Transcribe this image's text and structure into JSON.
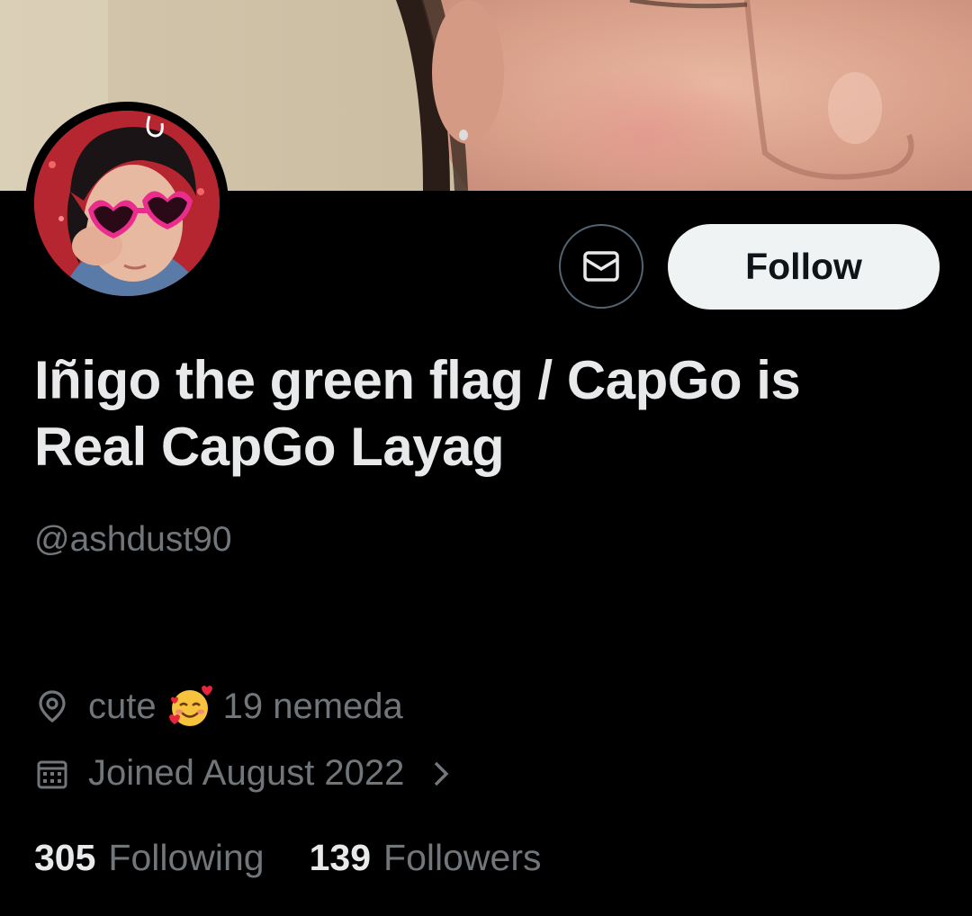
{
  "profile": {
    "display_name_line1": "Iñigo the green flag / CapGo is",
    "display_name_line2": "Real CapGo Layag",
    "handle": "@ashdust90",
    "location_text_before": "cute",
    "location_emoji": "smiling-face-with-hearts-icon",
    "location_text_after": "19 nemeda",
    "joined": "Joined August 2022"
  },
  "actions": {
    "follow_label": "Follow",
    "message_icon": "envelope-icon"
  },
  "stats": {
    "following_count": "305",
    "following_label": "Following",
    "followers_count": "139",
    "followers_label": "Followers"
  },
  "colors": {
    "background": "#000000",
    "primary_text": "#e7e9ea",
    "secondary_text": "#71767b",
    "follow_button_bg": "#eff3f4",
    "border": "#536471"
  }
}
